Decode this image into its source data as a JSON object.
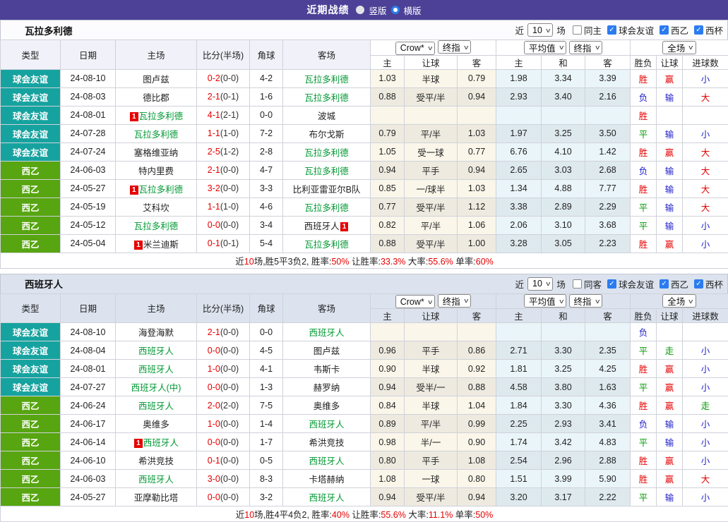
{
  "topbar": {
    "title": "近期战绩",
    "radio_vertical": "竖版",
    "radio_horizontal": "横版"
  },
  "colors": {
    "accent_purple": "#4c4197",
    "friendly_teal": "#16a3a0",
    "league_green": "#57a510",
    "team_green": "#009933",
    "red": "#e60000",
    "blue": "#2222cc",
    "green": "#009900",
    "checkbox_blue": "#2b7cf0",
    "crow_bg": "#fbf6ea",
    "avg_bg": "#eaf5f9"
  },
  "labels": {
    "near": "近",
    "games": "场",
    "left_headers": [
      "类型",
      "日期",
      "主场",
      "比分(半场)",
      "角球",
      "客场"
    ],
    "sub_headers": [
      "主",
      "让球",
      "客",
      "主",
      "和",
      "客",
      "胜负",
      "让球",
      "进球数"
    ],
    "select_group1": [
      "Crow*",
      "终指"
    ],
    "select_group2": [
      "平均值",
      "终指"
    ],
    "select_group3": [
      "全场"
    ]
  },
  "tables": [
    {
      "name": "瓦拉多利德",
      "games_count": "10",
      "filters": [
        {
          "label": "同主",
          "checked": false
        },
        {
          "label": "球会友谊",
          "checked": true
        },
        {
          "label": "西乙",
          "checked": true
        },
        {
          "label": "西杯",
          "checked": true
        }
      ],
      "rows": [
        {
          "league": "球会友谊",
          "lt": "f",
          "date": "24-08-10",
          "home": {
            "t": "图卢兹"
          },
          "score": "0-2",
          "half": "(0-0)",
          "corner": "4-2",
          "away": {
            "t": "瓦拉多利德",
            "g": true
          },
          "o": [
            "1.03",
            "半球",
            "0.79",
            "1.98",
            "3.34",
            "3.39"
          ],
          "res": [
            "胜",
            "r"
          ],
          "hand": [
            "赢",
            "r"
          ],
          "goal": [
            "小",
            "b"
          ]
        },
        {
          "league": "球会友谊",
          "lt": "f",
          "date": "24-08-03",
          "home": {
            "t": "德比郡"
          },
          "score": "2-1",
          "half": "(0-1)",
          "corner": "1-6",
          "away": {
            "t": "瓦拉多利德",
            "g": true
          },
          "o": [
            "0.88",
            "受平/半",
            "0.94",
            "2.93",
            "3.40",
            "2.16"
          ],
          "res": [
            "负",
            "b"
          ],
          "hand": [
            "输",
            "b"
          ],
          "goal": [
            "大",
            "r"
          ]
        },
        {
          "league": "球会友谊",
          "lt": "f",
          "date": "24-08-01",
          "home": {
            "t": "瓦拉多利德",
            "g": true,
            "b": "pre"
          },
          "score": "4-1",
          "half": "(2-1)",
          "corner": "0-0",
          "away": {
            "t": "波城"
          },
          "o": [
            "",
            "",
            "",
            "",
            "",
            ""
          ],
          "res": [
            "胜",
            "r"
          ],
          "hand": [
            "",
            "k"
          ],
          "goal": [
            "",
            "k"
          ]
        },
        {
          "league": "球会友谊",
          "lt": "f",
          "date": "24-07-28",
          "home": {
            "t": "瓦拉多利德",
            "g": true
          },
          "score": "1-1",
          "half": "(1-0)",
          "corner": "7-2",
          "away": {
            "t": "布尔戈斯"
          },
          "o": [
            "0.79",
            "平/半",
            "1.03",
            "1.97",
            "3.25",
            "3.50"
          ],
          "res": [
            "平",
            "g"
          ],
          "hand": [
            "输",
            "b"
          ],
          "goal": [
            "小",
            "b"
          ]
        },
        {
          "league": "球会友谊",
          "lt": "f",
          "date": "24-07-24",
          "home": {
            "t": "塞格维亚纳"
          },
          "score": "2-5",
          "half": "(1-2)",
          "corner": "2-8",
          "away": {
            "t": "瓦拉多利德",
            "g": true
          },
          "o": [
            "1.05",
            "受一球",
            "0.77",
            "6.76",
            "4.10",
            "1.42"
          ],
          "res": [
            "胜",
            "r"
          ],
          "hand": [
            "赢",
            "r"
          ],
          "goal": [
            "大",
            "r"
          ]
        },
        {
          "league": "西乙",
          "lt": "l",
          "date": "24-06-03",
          "home": {
            "t": "特内里费"
          },
          "score": "2-1",
          "half": "(0-0)",
          "corner": "4-7",
          "away": {
            "t": "瓦拉多利德",
            "g": true
          },
          "o": [
            "0.94",
            "平手",
            "0.94",
            "2.65",
            "3.03",
            "2.68"
          ],
          "res": [
            "负",
            "b"
          ],
          "hand": [
            "输",
            "b"
          ],
          "goal": [
            "大",
            "r"
          ]
        },
        {
          "league": "西乙",
          "lt": "l",
          "date": "24-05-27",
          "home": {
            "t": "瓦拉多利德",
            "g": true,
            "b": "pre"
          },
          "score": "3-2",
          "half": "(0-0)",
          "corner": "3-3",
          "away": {
            "t": "比利亚雷亚尔B队"
          },
          "o": [
            "0.85",
            "一/球半",
            "1.03",
            "1.34",
            "4.88",
            "7.77"
          ],
          "res": [
            "胜",
            "r"
          ],
          "hand": [
            "输",
            "b"
          ],
          "goal": [
            "大",
            "r"
          ]
        },
        {
          "league": "西乙",
          "lt": "l",
          "date": "24-05-19",
          "home": {
            "t": "艾科坎"
          },
          "score": "1-1",
          "half": "(1-0)",
          "corner": "4-6",
          "away": {
            "t": "瓦拉多利德",
            "g": true
          },
          "o": [
            "0.77",
            "受平/半",
            "1.12",
            "3.38",
            "2.89",
            "2.29"
          ],
          "res": [
            "平",
            "g"
          ],
          "hand": [
            "输",
            "b"
          ],
          "goal": [
            "大",
            "r"
          ]
        },
        {
          "league": "西乙",
          "lt": "l",
          "date": "24-05-12",
          "home": {
            "t": "瓦拉多利德",
            "g": true
          },
          "score": "0-0",
          "half": "(0-0)",
          "corner": "3-4",
          "away": {
            "t": "西班牙人",
            "b": "post"
          },
          "o": [
            "0.82",
            "平/半",
            "1.06",
            "2.06",
            "3.10",
            "3.68"
          ],
          "res": [
            "平",
            "g"
          ],
          "hand": [
            "输",
            "b"
          ],
          "goal": [
            "小",
            "b"
          ]
        },
        {
          "league": "西乙",
          "lt": "l",
          "date": "24-05-04",
          "home": {
            "t": "米兰迪斯",
            "b": "pre"
          },
          "score": "0-1",
          "half": "(0-1)",
          "corner": "5-4",
          "away": {
            "t": "瓦拉多利德",
            "g": true
          },
          "o": [
            "0.88",
            "受平/半",
            "1.00",
            "3.28",
            "3.05",
            "2.23"
          ],
          "res": [
            "胜",
            "r"
          ],
          "hand": [
            "赢",
            "r"
          ],
          "goal": [
            "小",
            "b"
          ]
        }
      ],
      "summary": [
        [
          "近",
          "k"
        ],
        [
          "10",
          "r"
        ],
        [
          "场,胜5平3负2, 胜率:",
          "k"
        ],
        [
          "50%",
          "r"
        ],
        [
          " 让胜率:",
          "k"
        ],
        [
          "33.3%",
          "r"
        ],
        [
          " 大率:",
          "k"
        ],
        [
          "55.6%",
          "r"
        ],
        [
          " 单率:",
          "k"
        ],
        [
          "60%",
          "r"
        ]
      ]
    },
    {
      "name": "西班牙人",
      "games_count": "10",
      "filters": [
        {
          "label": "同客",
          "checked": false
        },
        {
          "label": "球会友谊",
          "checked": true
        },
        {
          "label": "西乙",
          "checked": true
        },
        {
          "label": "西杯",
          "checked": true
        }
      ],
      "rows": [
        {
          "league": "球会友谊",
          "lt": "f",
          "date": "24-08-10",
          "home": {
            "t": "海登海默"
          },
          "score": "2-1",
          "half": "(0-0)",
          "corner": "0-0",
          "away": {
            "t": "西班牙人",
            "g": true
          },
          "o": [
            "",
            "",
            "",
            "",
            "",
            ""
          ],
          "res": [
            "负",
            "b"
          ],
          "hand": [
            "",
            "k"
          ],
          "goal": [
            "",
            "k"
          ]
        },
        {
          "league": "球会友谊",
          "lt": "f",
          "date": "24-08-04",
          "home": {
            "t": "西班牙人",
            "g": true
          },
          "score": "0-0",
          "half": "(0-0)",
          "corner": "4-5",
          "away": {
            "t": "图卢兹"
          },
          "o": [
            "0.96",
            "平手",
            "0.86",
            "2.71",
            "3.30",
            "2.35"
          ],
          "res": [
            "平",
            "g"
          ],
          "hand": [
            "走",
            "g"
          ],
          "goal": [
            "小",
            "b"
          ]
        },
        {
          "league": "球会友谊",
          "lt": "f",
          "date": "24-08-01",
          "home": {
            "t": "西班牙人",
            "g": true
          },
          "score": "1-0",
          "half": "(0-0)",
          "corner": "4-1",
          "away": {
            "t": "韦斯卡"
          },
          "o": [
            "0.90",
            "半球",
            "0.92",
            "1.81",
            "3.25",
            "4.25"
          ],
          "res": [
            "胜",
            "r"
          ],
          "hand": [
            "赢",
            "r"
          ],
          "goal": [
            "小",
            "b"
          ]
        },
        {
          "league": "球会友谊",
          "lt": "f",
          "date": "24-07-27",
          "home": {
            "t": "西班牙人(中)",
            "g": true
          },
          "score": "0-0",
          "half": "(0-0)",
          "corner": "1-3",
          "away": {
            "t": "赫罗纳"
          },
          "o": [
            "0.94",
            "受半/一",
            "0.88",
            "4.58",
            "3.80",
            "1.63"
          ],
          "res": [
            "平",
            "g"
          ],
          "hand": [
            "赢",
            "r"
          ],
          "goal": [
            "小",
            "b"
          ]
        },
        {
          "league": "西乙",
          "lt": "l",
          "date": "24-06-24",
          "home": {
            "t": "西班牙人",
            "g": true
          },
          "score": "2-0",
          "half": "(2-0)",
          "corner": "7-5",
          "away": {
            "t": "奥维多"
          },
          "o": [
            "0.84",
            "半球",
            "1.04",
            "1.84",
            "3.30",
            "4.36"
          ],
          "res": [
            "胜",
            "r"
          ],
          "hand": [
            "赢",
            "r"
          ],
          "goal": [
            "走",
            "g"
          ]
        },
        {
          "league": "西乙",
          "lt": "l",
          "date": "24-06-17",
          "home": {
            "t": "奥维多"
          },
          "score": "1-0",
          "half": "(0-0)",
          "corner": "1-4",
          "away": {
            "t": "西班牙人",
            "g": true
          },
          "o": [
            "0.89",
            "平/半",
            "0.99",
            "2.25",
            "2.93",
            "3.41"
          ],
          "res": [
            "负",
            "b"
          ],
          "hand": [
            "输",
            "b"
          ],
          "goal": [
            "小",
            "b"
          ]
        },
        {
          "league": "西乙",
          "lt": "l",
          "date": "24-06-14",
          "home": {
            "t": "西班牙人",
            "g": true,
            "b": "pre"
          },
          "score": "0-0",
          "half": "(0-0)",
          "corner": "1-7",
          "away": {
            "t": "希洪竞技"
          },
          "o": [
            "0.98",
            "半/一",
            "0.90",
            "1.74",
            "3.42",
            "4.83"
          ],
          "res": [
            "平",
            "g"
          ],
          "hand": [
            "输",
            "b"
          ],
          "goal": [
            "小",
            "b"
          ]
        },
        {
          "league": "西乙",
          "lt": "l",
          "date": "24-06-10",
          "home": {
            "t": "希洪竞技"
          },
          "score": "0-1",
          "half": "(0-0)",
          "corner": "0-5",
          "away": {
            "t": "西班牙人",
            "g": true
          },
          "o": [
            "0.80",
            "平手",
            "1.08",
            "2.54",
            "2.96",
            "2.88"
          ],
          "res": [
            "胜",
            "r"
          ],
          "hand": [
            "赢",
            "r"
          ],
          "goal": [
            "小",
            "b"
          ]
        },
        {
          "league": "西乙",
          "lt": "l",
          "date": "24-06-03",
          "home": {
            "t": "西班牙人",
            "g": true
          },
          "score": "3-0",
          "half": "(0-0)",
          "corner": "8-3",
          "away": {
            "t": "卡塔赫纳"
          },
          "o": [
            "1.08",
            "一球",
            "0.80",
            "1.51",
            "3.99",
            "5.90"
          ],
          "res": [
            "胜",
            "r"
          ],
          "hand": [
            "赢",
            "r"
          ],
          "goal": [
            "大",
            "r"
          ]
        },
        {
          "league": "西乙",
          "lt": "l",
          "date": "24-05-27",
          "home": {
            "t": "亚摩勒比塔"
          },
          "score": "0-0",
          "half": "(0-0)",
          "corner": "3-2",
          "away": {
            "t": "西班牙人",
            "g": true
          },
          "o": [
            "0.94",
            "受平/半",
            "0.94",
            "3.20",
            "3.17",
            "2.22"
          ],
          "res": [
            "平",
            "g"
          ],
          "hand": [
            "输",
            "b"
          ],
          "goal": [
            "小",
            "b"
          ]
        }
      ],
      "summary": [
        [
          "近",
          "k"
        ],
        [
          "10",
          "r"
        ],
        [
          "场,胜4平4负2, 胜率:",
          "k"
        ],
        [
          "40%",
          "r"
        ],
        [
          " 让胜率:",
          "k"
        ],
        [
          "55.6%",
          "r"
        ],
        [
          " 大率:",
          "k"
        ],
        [
          "11.1%",
          "r"
        ],
        [
          " 单率:",
          "k"
        ],
        [
          "50%",
          "r"
        ]
      ]
    }
  ]
}
